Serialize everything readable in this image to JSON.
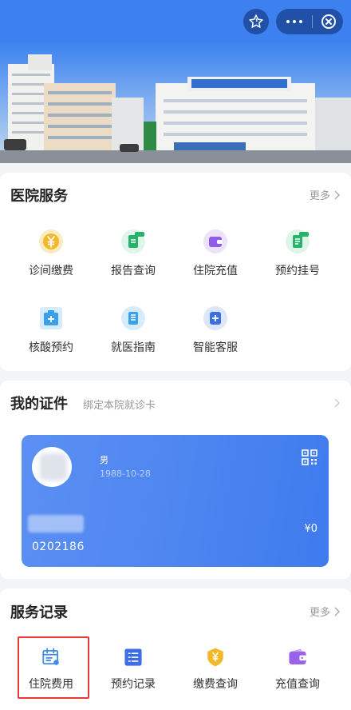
{
  "header": {
    "favorite_icon": "star-icon",
    "more_icon": "ellipsis-icon",
    "close_icon": "close-circle-icon"
  },
  "hospital_services": {
    "title": "医院服务",
    "more": "更多",
    "items": [
      {
        "label": "诊间缴费",
        "icon": "yuan-coin-icon"
      },
      {
        "label": "报告查询",
        "icon": "report-icon"
      },
      {
        "label": "住院充值",
        "icon": "wallet-icon"
      },
      {
        "label": "预约挂号",
        "icon": "appointment-icon"
      },
      {
        "label": "核酸预约",
        "icon": "medical-kit-icon"
      },
      {
        "label": "就医指南",
        "icon": "guide-icon"
      },
      {
        "label": "智能客服",
        "icon": "customer-service-icon"
      }
    ]
  },
  "my_documents": {
    "title": "我的证件",
    "subtitle": "绑定本院就诊卡",
    "card": {
      "gender": "男",
      "birth_date": "1988-10-28",
      "balance": "¥0",
      "card_number": "0202186",
      "qr_icon": "qr-code-icon"
    }
  },
  "service_records": {
    "title": "服务记录",
    "more": "更多",
    "items": [
      {
        "label": "住院费用",
        "icon": "hospital-fee-icon"
      },
      {
        "label": "预约记录",
        "icon": "list-icon"
      },
      {
        "label": "缴费查询",
        "icon": "yuan-badge-icon"
      },
      {
        "label": "充值查询",
        "icon": "wallet-icon"
      }
    ]
  },
  "colors": {
    "topbar": "#3d80f0",
    "card_gradient": "#4d85f0",
    "highlight": "#e53935"
  }
}
